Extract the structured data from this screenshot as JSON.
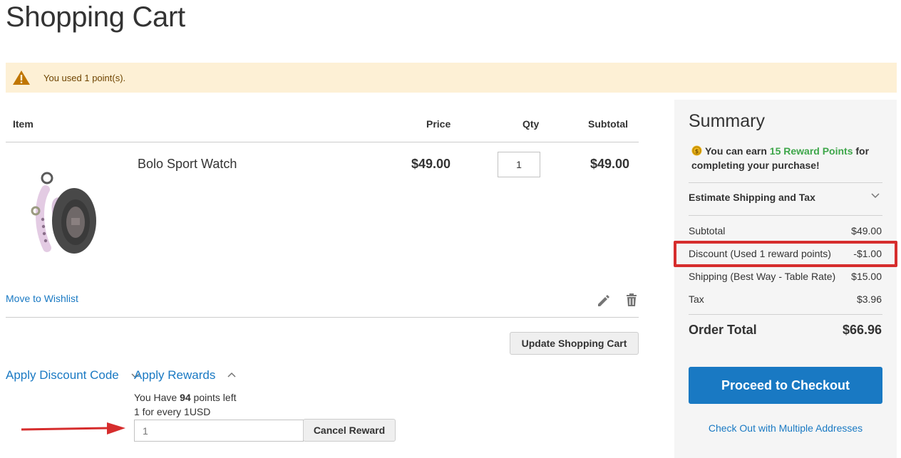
{
  "page": {
    "title": "Shopping Cart"
  },
  "notice": {
    "text": "You used 1 point(s).",
    "icon": "warning-triangle-icon"
  },
  "cart": {
    "headers": {
      "item": "Item",
      "price": "Price",
      "qty": "Qty",
      "subtotal": "Subtotal"
    },
    "items": [
      {
        "name": "Bolo Sport Watch",
        "price": "$49.00",
        "qty": "1",
        "subtotal": "$49.00"
      }
    ],
    "move_to_wishlist": "Move to Wishlist",
    "update_button": "Update Shopping Cart"
  },
  "discount": {
    "label": "Apply Discount Code"
  },
  "rewards": {
    "label": "Apply Rewards",
    "have_prefix": "You Have ",
    "points_left": "94",
    "have_suffix": " points left",
    "rate": "1 for every 1USD",
    "input_placeholder": "1",
    "cancel_button": "Cancel Reward"
  },
  "summary": {
    "title": "Summary",
    "earn_prefix": "You can earn ",
    "earn_points": "15 Reward Points",
    "earn_suffix": " for completing your purchase!",
    "estimate_shipping": "Estimate Shipping and Tax",
    "rows": [
      {
        "label": "Subtotal",
        "value": "$49.00"
      },
      {
        "label": "Discount (Used 1 reward points)",
        "value": "-$1.00"
      },
      {
        "label": "Shipping (Best Way - Table Rate)",
        "value": "$15.00"
      },
      {
        "label": "Tax",
        "value": "$3.96"
      }
    ],
    "order_total_label": "Order Total",
    "order_total_value": "$66.96",
    "checkout_button": "Proceed to Checkout",
    "multi_address_link": "Check Out with Multiple Addresses"
  },
  "colors": {
    "link": "#1979c3",
    "primary_button": "#1979c3",
    "notice_bg": "#fdf0d5",
    "highlight": "#d62d2d",
    "reward_points": "#3ea64a"
  }
}
